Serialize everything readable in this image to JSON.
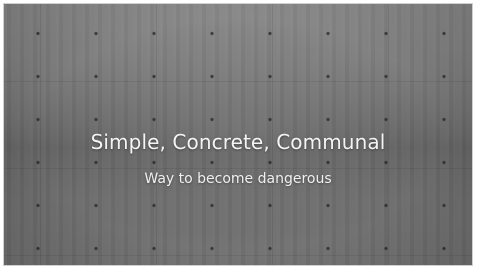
{
  "slide": {
    "title": "Simple, Concrete, Communal",
    "subtitle": "Way to become dangerous",
    "background": "concrete-wall-texture"
  }
}
